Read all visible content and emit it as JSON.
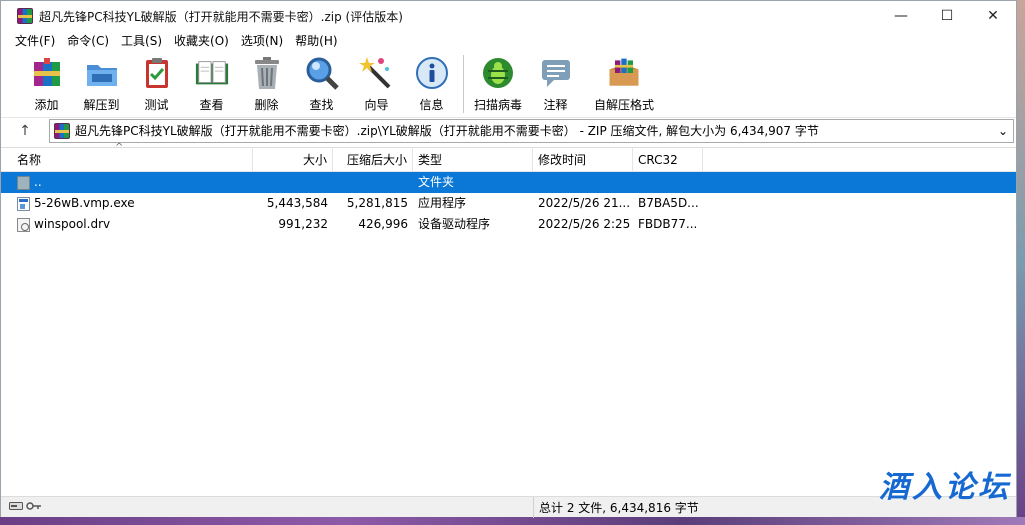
{
  "window": {
    "title": "超凡先锋PC科技YL破解版（打开就能用不需要卡密）.zip (评估版本)",
    "controls": {
      "minimize": "—",
      "maximize": "☐",
      "close": "✕"
    }
  },
  "menu": [
    "文件(F)",
    "命令(C)",
    "工具(S)",
    "收藏夹(O)",
    "选项(N)",
    "帮助(H)"
  ],
  "toolbar": {
    "add": "添加",
    "extract_to": "解压到",
    "test": "测试",
    "view": "查看",
    "delete": "删除",
    "find": "查找",
    "wizard": "向导",
    "info": "信息",
    "virus_scan": "扫描病毒",
    "comment": "注释",
    "sfx": "自解压格式"
  },
  "address": {
    "up": "↑",
    "path": "超凡先锋PC科技YL破解版（打开就能用不需要卡密）.zip\\YL破解版（打开就能用不需要卡密） - ZIP 压缩文件, 解包大小为 6,434,907 字节",
    "dropdown": "⌄"
  },
  "columns": {
    "name": "名称",
    "size": "大小",
    "packed": "压缩后大小",
    "type": "类型",
    "mtime": "修改时间",
    "crc": "CRC32",
    "sort_caret": "^"
  },
  "rows": [
    {
      "name": "..",
      "size": "",
      "packed": "",
      "type": "文件夹",
      "mtime": "",
      "crc": ""
    },
    {
      "name": "5-26wB.vmp.exe",
      "size": "5,443,584",
      "packed": "5,281,815",
      "type": "应用程序",
      "mtime": "2022/5/26 21...",
      "crc": "B7BA5D..."
    },
    {
      "name": "winspool.drv",
      "size": "991,232",
      "packed": "426,996",
      "type": "设备驱动程序",
      "mtime": "2022/5/26 2:25",
      "crc": "FBDB77..."
    }
  ],
  "status": {
    "summary": "总计 2 文件, 6,434,816 字节"
  },
  "watermark": "酒入论坛",
  "colors": {
    "selection": "#0b78d7",
    "watermark": "#1769d2"
  }
}
